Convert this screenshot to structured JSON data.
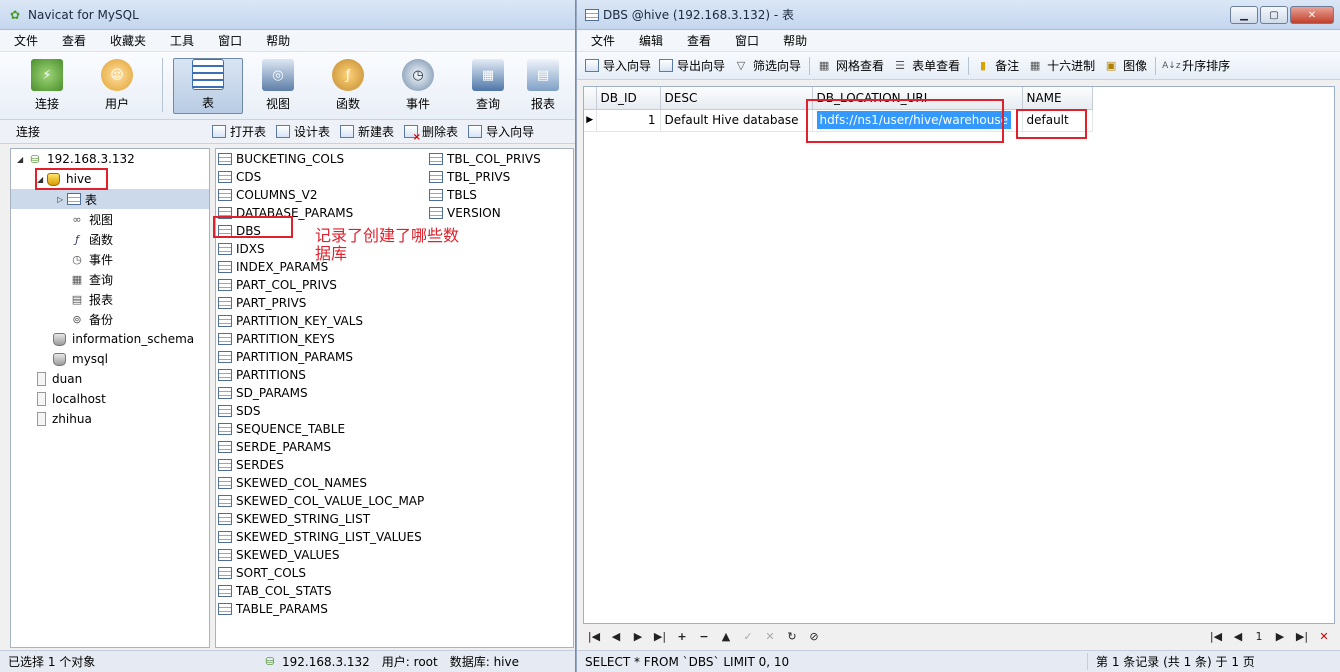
{
  "win1": {
    "title": "Navicat for MySQL",
    "menu": [
      "文件",
      "查看",
      "收藏夹",
      "工具",
      "窗口",
      "帮助"
    ],
    "toolbar": [
      {
        "label": "连接",
        "icon": "plug-icon",
        "color": "#4a8f2a"
      },
      {
        "label": "用户",
        "icon": "user-icon",
        "color": "#e0a030"
      },
      {
        "label": "表",
        "icon": "table-icon",
        "color": "#3b6fb6",
        "active": true
      },
      {
        "label": "视图",
        "icon": "view-icon",
        "color": "#5d7fa8"
      },
      {
        "label": "函数",
        "icon": "function-icon",
        "color": "#c08a2e"
      },
      {
        "label": "事件",
        "icon": "event-icon",
        "color": "#6f8aa9"
      },
      {
        "label": "查询",
        "icon": "query-icon",
        "color": "#4f76a8"
      },
      {
        "label": "报表",
        "icon": "report-icon",
        "color": "#7f9fc6"
      }
    ],
    "sub_label": "连接",
    "actions": [
      "打开表",
      "设计表",
      "新建表",
      "删除表",
      "导入向导"
    ],
    "tree": {
      "server": "192.168.3.132",
      "db": "hive",
      "children": [
        "表",
        "视图",
        "函数",
        "事件",
        "查询",
        "报表",
        "备份"
      ],
      "other_dbs": [
        "information_schema",
        "mysql"
      ],
      "connections": [
        "duan",
        "localhost",
        "zhihua"
      ]
    },
    "tables_col1": [
      "BUCKETING_COLS",
      "CDS",
      "COLUMNS_V2",
      "DATABASE_PARAMS",
      "DBS",
      "IDXS",
      "INDEX_PARAMS",
      "PART_COL_PRIVS",
      "PART_PRIVS",
      "PARTITION_KEY_VALS",
      "PARTITION_KEYS",
      "PARTITION_PARAMS",
      "PARTITIONS",
      "SD_PARAMS",
      "SDS",
      "SEQUENCE_TABLE",
      "SERDE_PARAMS",
      "SERDES",
      "SKEWED_COL_NAMES",
      "SKEWED_COL_VALUE_LOC_MAP",
      "SKEWED_STRING_LIST",
      "SKEWED_STRING_LIST_VALUES",
      "SKEWED_VALUES",
      "SORT_COLS",
      "TAB_COL_STATS",
      "TABLE_PARAMS"
    ],
    "tables_col2": [
      "TBL_COL_PRIVS",
      "TBL_PRIVS",
      "TBLS",
      "VERSION"
    ],
    "annotation": "记录了创建了哪些数据库",
    "status_left": "已选择 1 个对象",
    "status_server": "192.168.3.132",
    "status_user": "用户: root",
    "status_db": "数据库: hive"
  },
  "win2": {
    "title": "DBS @hive (192.168.3.132) - 表",
    "menu": [
      "文件",
      "编辑",
      "查看",
      "窗口",
      "帮助"
    ],
    "toolbar": [
      "导入向导",
      "导出向导",
      "筛选向导",
      "网格查看",
      "表单查看",
      "备注",
      "十六进制",
      "图像",
      "升序排序"
    ],
    "columns": [
      "DB_ID",
      "DESC",
      "DB_LOCATION_URI",
      "NAME"
    ],
    "rows": [
      [
        "1",
        "Default Hive database",
        "hdfs://ns1/user/hive/warehouse",
        "default"
      ]
    ],
    "page_num": "1",
    "status_sql": "SELECT * FROM `DBS` LIMIT 0, 10",
    "status_right": "第 1 条记录 (共 1 条) 于 1 页"
  }
}
